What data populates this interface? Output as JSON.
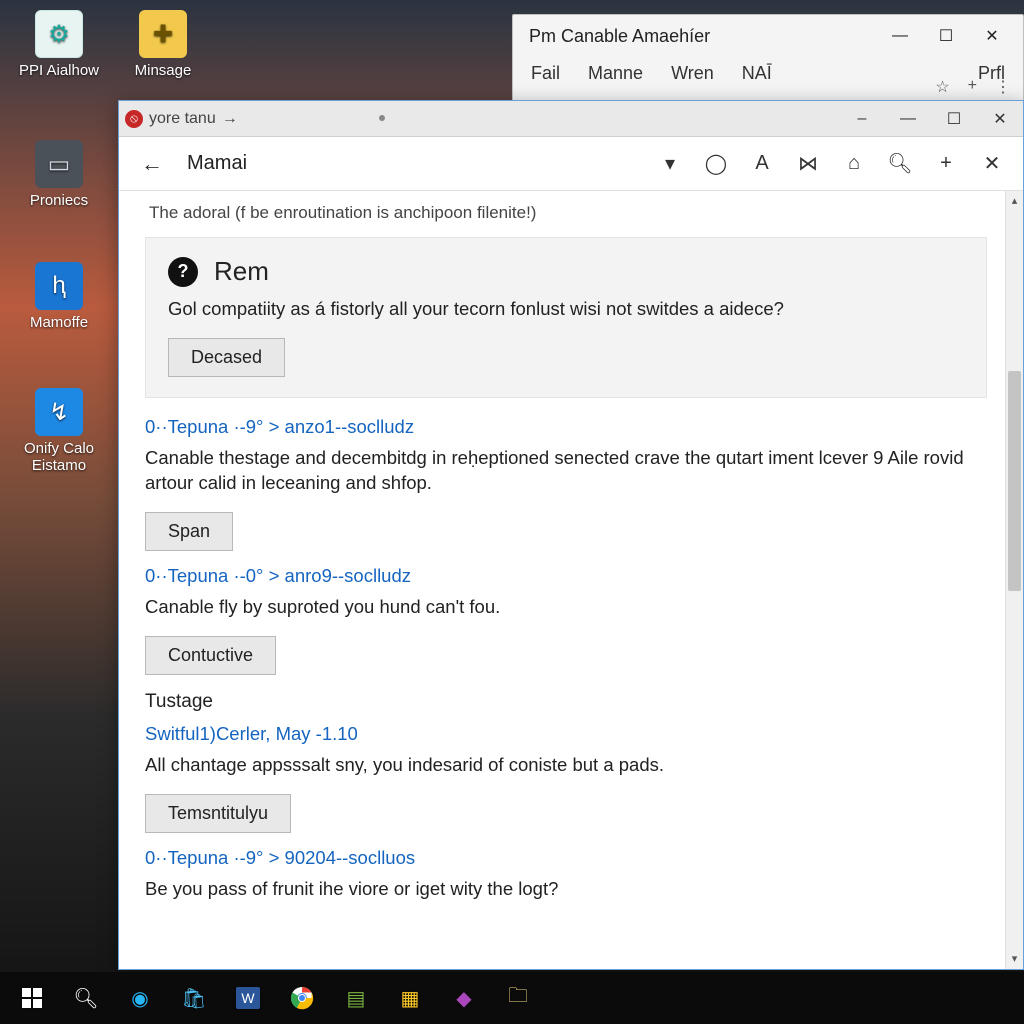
{
  "desktop_icons": [
    {
      "label": "PPI Aialhow",
      "bg": "#1aa89a",
      "glyph": "⚙"
    },
    {
      "label": "Minsage",
      "bg": "#f2c94c",
      "glyph": "✚"
    },
    {
      "label": "Proniecs",
      "bg": "#3a3f44",
      "glyph": "▭"
    },
    {
      "label": "Mamoffe",
      "bg": "#1976d2",
      "glyph": "ⱨ"
    },
    {
      "label": "Onify Calo Eistamo",
      "bg": "#1e88e5",
      "glyph": "↯"
    }
  ],
  "back_window": {
    "title": "Pm Canable Amaehíer",
    "menu": [
      "Fail",
      "Manne",
      "Wren",
      "NAĪ",
      "Prfl"
    ]
  },
  "front_window": {
    "tab_label": "yore tanu",
    "page_title": "Mamai",
    "subline": "The adoral (f be enroutination is anchipoon filenite!)",
    "toolbar_icons": [
      "dropdown",
      "refresh",
      "font",
      "bookmark",
      "home",
      "search",
      "plus",
      "close"
    ],
    "card": {
      "title": "Rem",
      "body": "Gol compatiity as á fistorly all your tecorn fonlust wisi not switdes a aidece?",
      "button": "Decased"
    },
    "entries": [
      {
        "link": "0··Tepuna ·-9° > anzo1--soclludz",
        "body": "Canable thestage and decembitdg in reḥeptioned senected crave the qutart iment lcever 9 Aile rovid artour calid in leceaning and shfop.",
        "button": "Span"
      },
      {
        "link": "0··Tepuna ·-0° > anro9--soclludz",
        "body": "Canable fly by suproted you hund can't fou.",
        "button": "Contuctive"
      }
    ],
    "section_heading": "Tustage",
    "section_entries": [
      {
        "link": "Switful1)Cerler, May -1.10",
        "body": "All chantage appsssalt sny, you indesarid of coniste but a pads.",
        "button": "Temsntitulyu"
      },
      {
        "link": "0··Tepuna ·-9° > 90204--soclluos",
        "body": "Be you pass of frunit ihe viore or iget wity the logt?"
      }
    ]
  },
  "taskbar": [
    "start",
    "search",
    "cortana",
    "store",
    "word",
    "chrome",
    "app1",
    "app2",
    "app3",
    "explorer"
  ]
}
